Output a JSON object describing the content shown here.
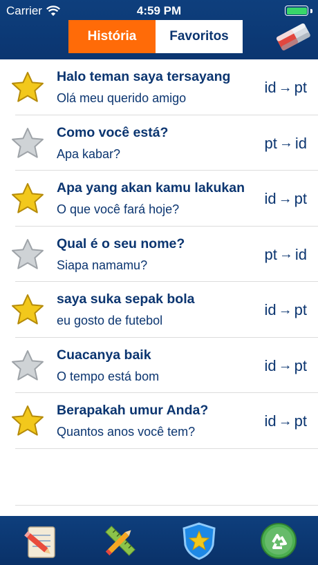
{
  "status_bar": {
    "carrier": "Carrier",
    "time": "4:59 PM"
  },
  "header": {
    "tabs": [
      {
        "label": "História",
        "active": true
      },
      {
        "label": "Favoritos",
        "active": false
      }
    ],
    "clear_icon": "eraser-icon"
  },
  "history": [
    {
      "favorite": true,
      "source": "Halo teman saya tersayang",
      "translation": "Olá meu querido amigo",
      "from": "id",
      "to": "pt"
    },
    {
      "favorite": false,
      "source": "Como você está?",
      "translation": "Apa kabar?",
      "from": "pt",
      "to": "id"
    },
    {
      "favorite": true,
      "source": "Apa yang akan kamu lakukan",
      "translation": "O que você fará hoje?",
      "from": "id",
      "to": "pt"
    },
    {
      "favorite": false,
      "source": "Qual é o seu nome?",
      "translation": "Siapa namamu?",
      "from": "pt",
      "to": "id"
    },
    {
      "favorite": true,
      "source": "saya suka sepak bola",
      "translation": "eu gosto de futebol",
      "from": "id",
      "to": "pt"
    },
    {
      "favorite": false,
      "source": "Cuacanya baik",
      "translation": "O tempo está bom",
      "from": "id",
      "to": "pt"
    },
    {
      "favorite": true,
      "source": "Berapakah umur Anda?",
      "translation": "Quantos anos você tem?",
      "from": "id",
      "to": "pt"
    }
  ],
  "tab_bar": [
    "notepad-pencil-icon",
    "ruler-pencil-icon",
    "star-shield-icon",
    "recycle-icon"
  ],
  "colors": {
    "header": "#0b3570",
    "accent": "#ff6b08",
    "star_gold": "#f2c81c",
    "star_gray": "#cfd3d6"
  }
}
